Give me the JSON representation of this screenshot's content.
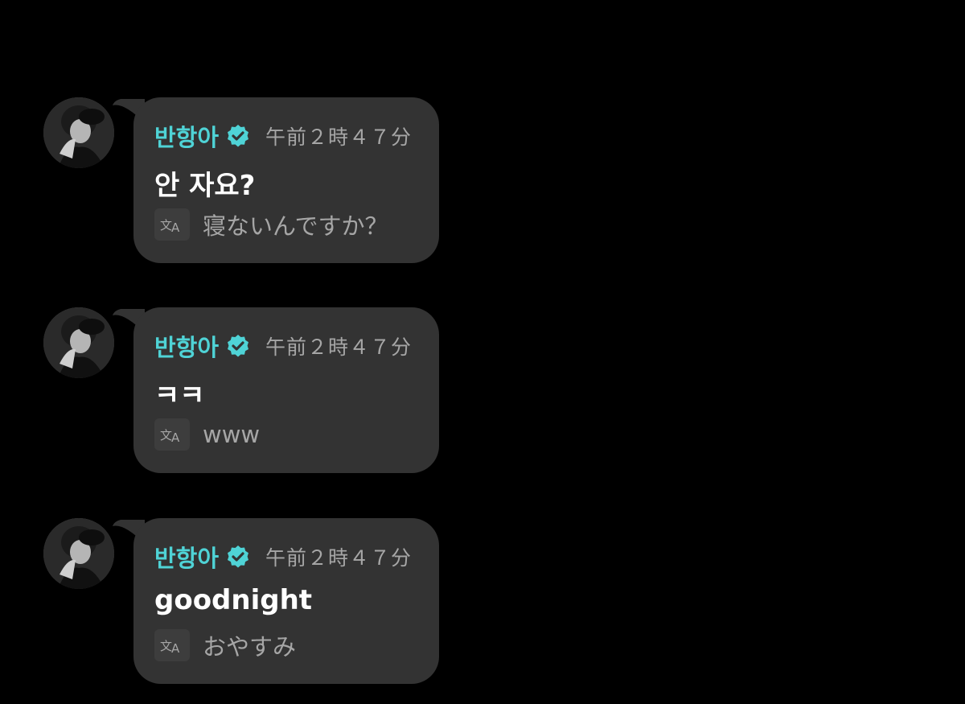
{
  "messages": [
    {
      "author": "반항아",
      "verified": true,
      "time": "午前２時４７分",
      "text": "안 자요?",
      "translation": "寝ないんですか？",
      "avatar_icon": "avatar-photo",
      "translate_icon": "translate-icon"
    },
    {
      "author": "반항아",
      "verified": true,
      "time": "午前２時４７分",
      "text": "ㅋㅋ",
      "translation": "www",
      "avatar_icon": "avatar-photo",
      "translate_icon": "translate-icon"
    },
    {
      "author": "반항아",
      "verified": true,
      "time": "午前２時４７分",
      "text": "goodnight",
      "translation": "おやすみ",
      "avatar_icon": "avatar-photo",
      "translate_icon": "translate-icon"
    }
  ],
  "colors": {
    "background": "#000000",
    "bubble": "#333333",
    "name": "#4fd3d6",
    "verified_badge": "#4fd3d6",
    "time": "#a6a6a6",
    "text": "#ffffff",
    "translation": "#a6a6a6"
  }
}
